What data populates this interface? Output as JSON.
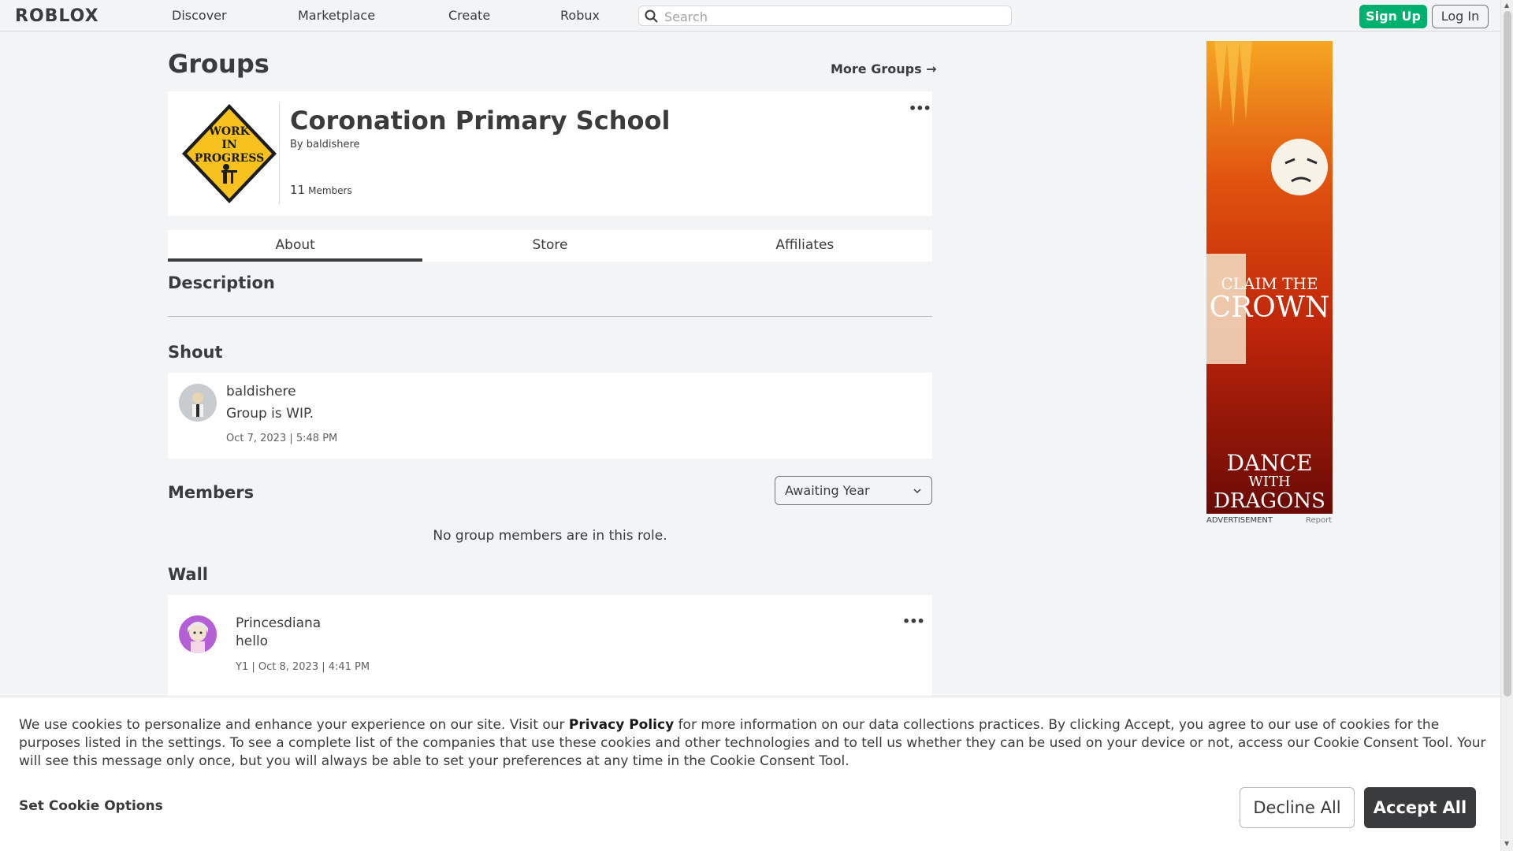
{
  "header": {
    "logo_text": "ROBLOX",
    "nav": [
      "Discover",
      "Marketplace",
      "Create",
      "Robux"
    ],
    "search_placeholder": "Search",
    "signup_label": "Sign Up",
    "login_label": "Log In"
  },
  "page": {
    "title": "Groups",
    "more_groups_label": "More Groups →"
  },
  "group": {
    "name": "Coronation Primary School",
    "by_prefix": "By",
    "owner": "baldishere",
    "member_count": "11",
    "member_label": "Members",
    "emblem_text": [
      "WORK",
      "IN",
      "PROGRESS"
    ],
    "menu_icon": "more-horizontal-icon"
  },
  "tabs": [
    "About",
    "Store",
    "Affiliates"
  ],
  "active_tab": "About",
  "sections": {
    "description": "Description",
    "shout": "Shout",
    "members": "Members",
    "wall": "Wall"
  },
  "shout": {
    "user": "baldishere",
    "body": "Group is WIP.",
    "date": "Oct 7, 2023 | 5:48 PM"
  },
  "members": {
    "role_selected": "Awaiting Year",
    "empty_message": "No group members are in this role."
  },
  "wall_posts": [
    {
      "user": "Princesdiana",
      "body": "hello",
      "meta": "Y1 | Oct 8, 2023 | 4:41 PM"
    }
  ],
  "ad": {
    "headline_1": "CLAIM THE",
    "headline_2": "CROWN",
    "footer_1": "DANCE",
    "footer_2": "WITH",
    "footer_3": "DRAGONS",
    "label": "ADVERTISEMENT",
    "report": "Report"
  },
  "cookie": {
    "text_before_link": "We use cookies to personalize and enhance your experience on our site. Visit our ",
    "link": "Privacy Policy",
    "text_after_link": " for more information on our data collections practices. By clicking Accept, you agree to our use of cookies for the purposes listed in the settings. To see a complete list of the companies that use these cookies and other technologies and to tell us whether they can be used on your device or not, access our Cookie Consent Tool. Your will see this message only once, but you will always be able to set your preferences at any time in the Cookie Consent Tool.",
    "options_label": "Set Cookie Options",
    "decline_label": "Decline All",
    "accept_label": "Accept All"
  },
  "colors": {
    "signup": "#00b06f",
    "page_bg": "#f2f4f5",
    "text": "#393b3d",
    "accept_bg": "#393b3d"
  }
}
